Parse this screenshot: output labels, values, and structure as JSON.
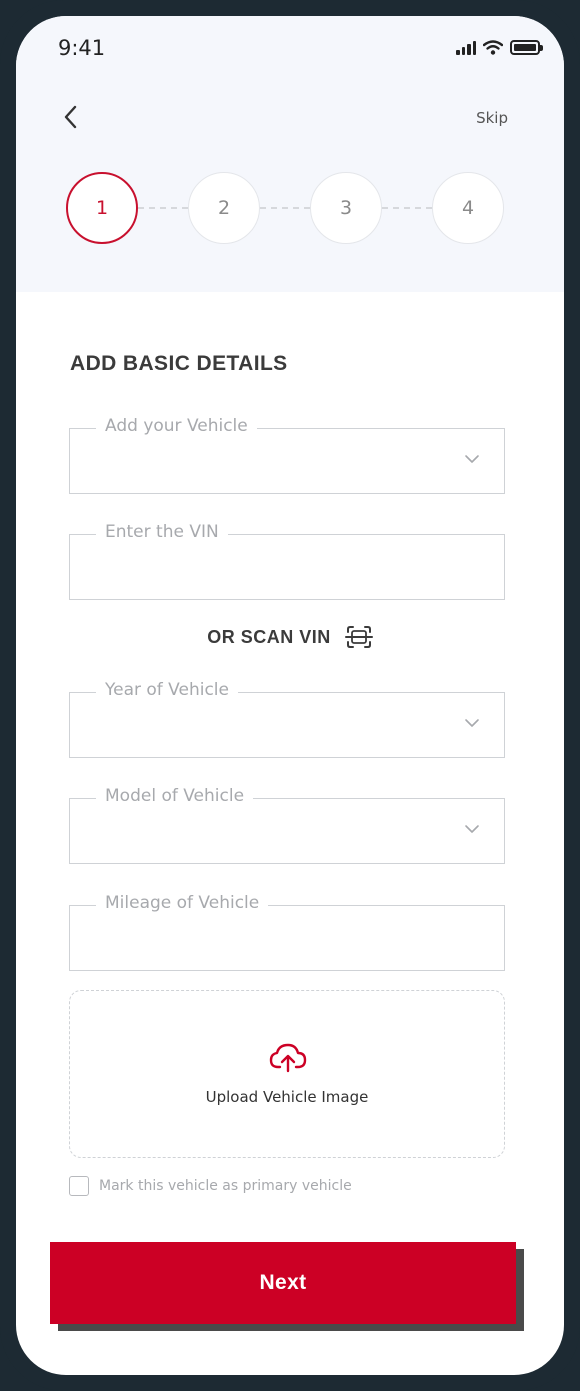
{
  "status_bar": {
    "time": "9:41"
  },
  "nav": {
    "skip_label": "Skip"
  },
  "stepper": {
    "steps": [
      "1",
      "2",
      "3",
      "4"
    ],
    "active_step": "1"
  },
  "form": {
    "title": "ADD BASIC DETAILS",
    "vehicle_label": "Add your Vehicle",
    "vin_label": "Enter the VIN",
    "scan_label": "OR SCAN VIN",
    "year_label": "Year of Vehicle",
    "model_label": "Model of Vehicle",
    "mileage_label": "Mileage of Vehicle",
    "upload_label": "Upload Vehicle Image",
    "primary_checkbox_label": "Mark this vehicle as primary vehicle",
    "primary_checked": false
  },
  "actions": {
    "next_label": "Next"
  },
  "colors": {
    "accent": "#cc0025",
    "active_step": "#c8102e",
    "header_bg": "#f5f7fc",
    "frame": "#1d2a33"
  },
  "icons": {
    "back": "chevron-left-icon",
    "dropdown": "chevron-down-icon",
    "scan": "scan-icon",
    "upload": "cloud-upload-icon"
  }
}
